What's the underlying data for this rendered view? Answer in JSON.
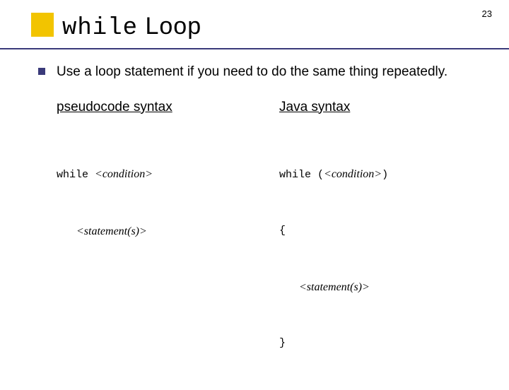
{
  "page_number": "23",
  "title": {
    "keyword": "while",
    "word": " Loop"
  },
  "bullet": "Use a loop statement if you need to do the same thing repeatedly.",
  "left": {
    "heading": "pseudocode syntax",
    "line1_kw": "while ",
    "line1_it": "<condition>",
    "line2_it": "<statement(s)>"
  },
  "right": {
    "heading": "Java syntax",
    "line1_kw": "while ",
    "line1_paren_open": "(",
    "line1_it": "<condition>",
    "line1_paren_close": ")",
    "line2": "{",
    "line3_it": "<statement(s)>",
    "line4": "}"
  }
}
